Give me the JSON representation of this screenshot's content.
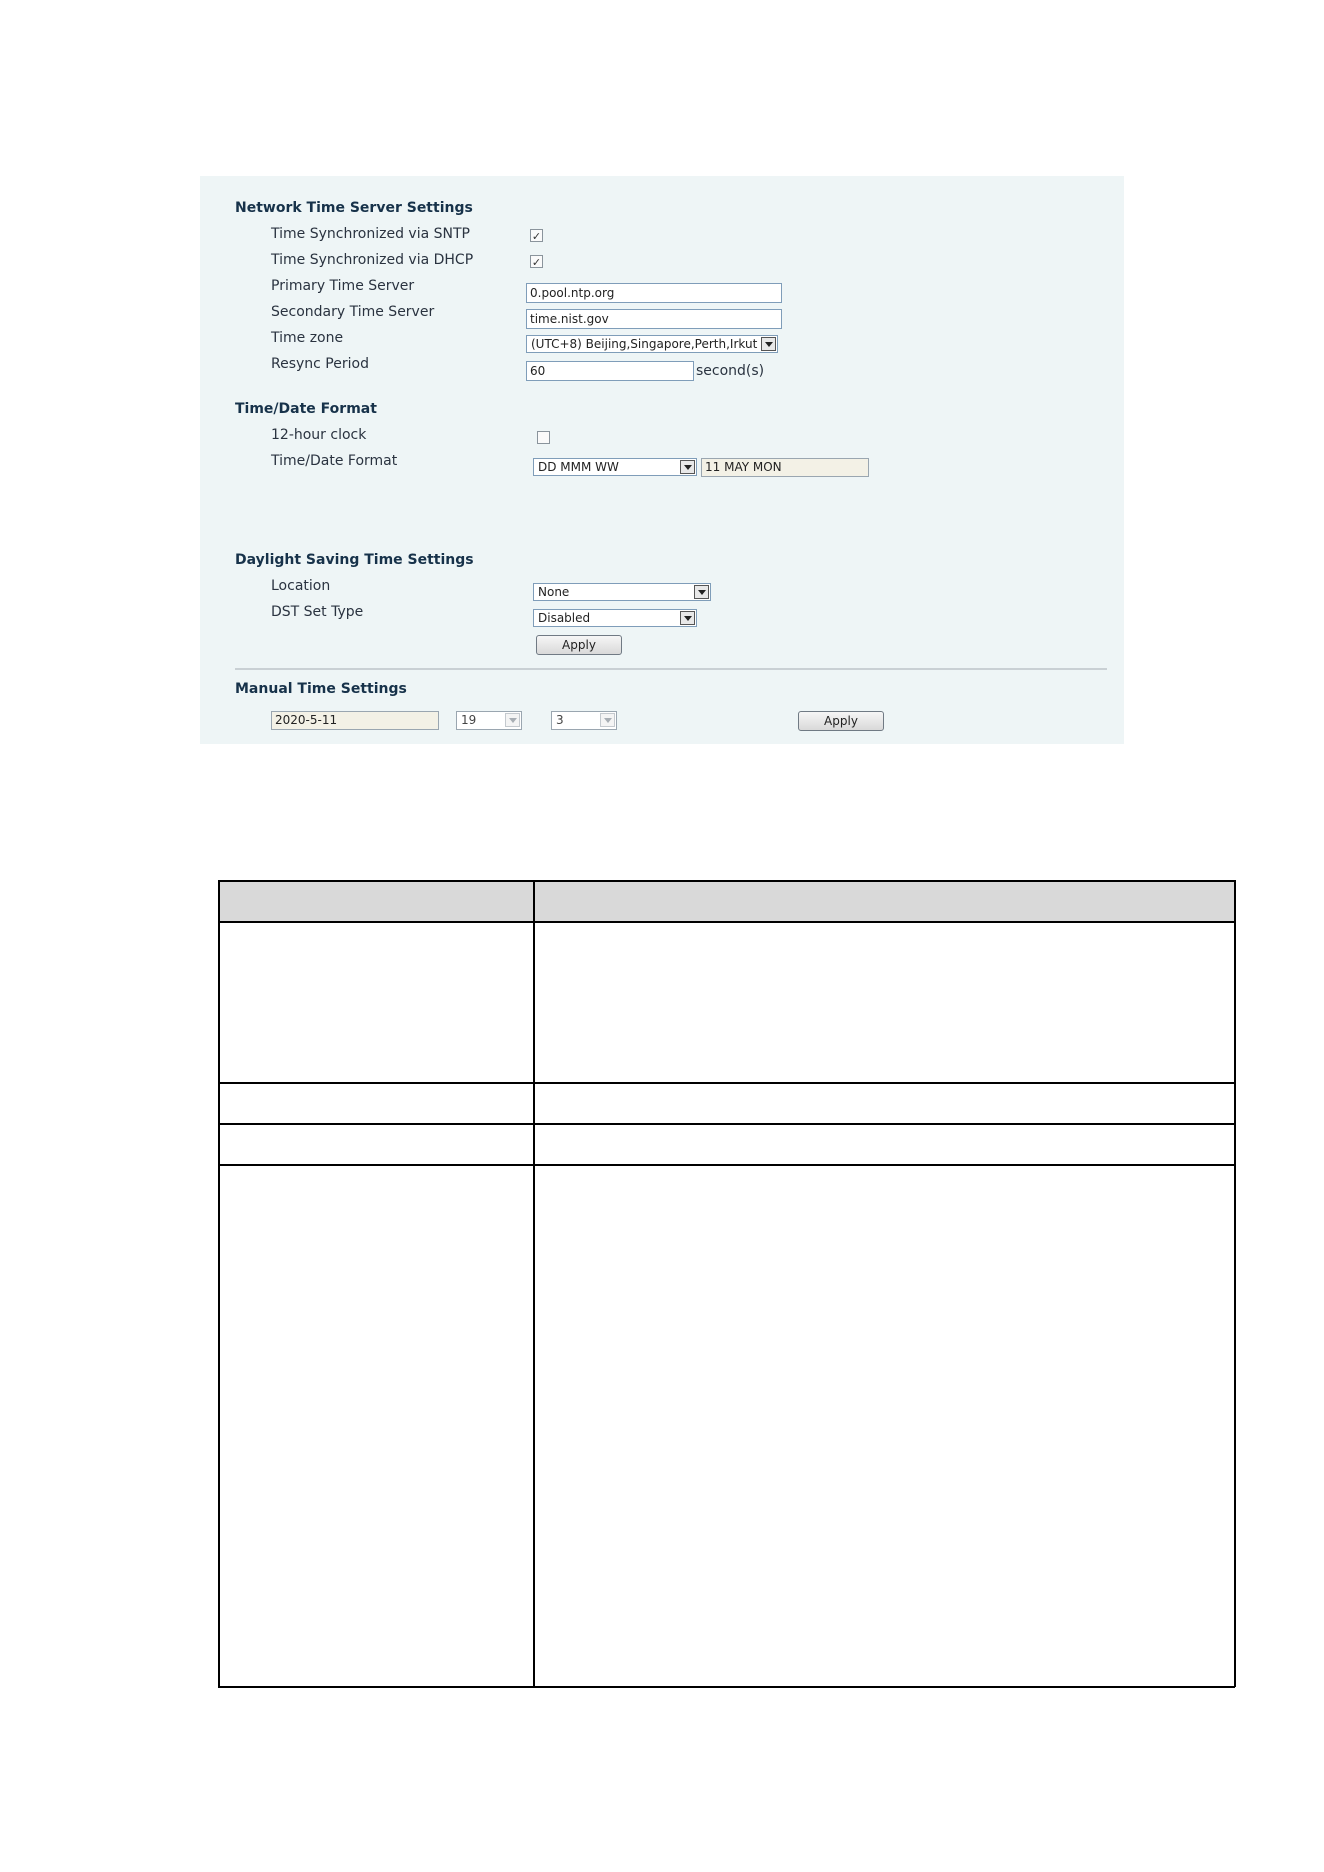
{
  "network_time": {
    "title": "Network Time Server Settings",
    "sntp_label": "Time Synchronized via SNTP",
    "sntp_checked": true,
    "dhcp_label": "Time Synchronized via DHCP",
    "dhcp_checked": true,
    "primary_label": "Primary Time Server",
    "primary_value": "0.pool.ntp.org",
    "secondary_label": "Secondary Time Server",
    "secondary_value": "time.nist.gov",
    "timezone_label": "Time zone",
    "timezone_value": "(UTC+8) Beijing,Singapore,Perth,Irkut",
    "resync_label": "Resync Period",
    "resync_value": "60",
    "resync_unit": "second(s)"
  },
  "time_date_format": {
    "title": "Time/Date Format",
    "clock_label": "12-hour clock",
    "clock_checked": false,
    "format_label": "Time/Date Format",
    "format_value": "DD MMM WW",
    "format_preview": "11 MAY MON"
  },
  "dst": {
    "title": "Daylight Saving Time Settings",
    "location_label": "Location",
    "location_value": "None",
    "type_label": "DST Set Type",
    "type_value": "Disabled",
    "apply_label": "Apply"
  },
  "manual_time": {
    "title": "Manual Time Settings",
    "date_value": "2020-5-11",
    "hour_value": "19",
    "minute_value": "3",
    "apply_label": "Apply"
  },
  "colors": {
    "panel_bg": "#eef5f6",
    "title_text": "#17324a",
    "input_border": "#7f9db9",
    "table_header_bg": "#d9d9d9"
  }
}
